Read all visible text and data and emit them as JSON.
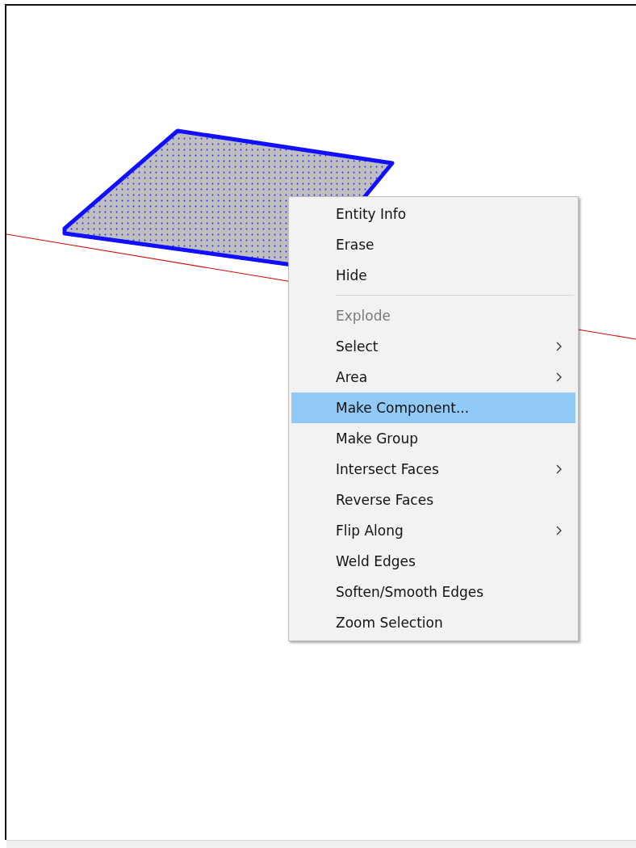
{
  "context_menu": {
    "items": [
      {
        "kind": "item",
        "label": "Entity Info",
        "disabled": false,
        "submenu": false,
        "selected": false
      },
      {
        "kind": "item",
        "label": "Erase",
        "disabled": false,
        "submenu": false,
        "selected": false
      },
      {
        "kind": "item",
        "label": "Hide",
        "disabled": false,
        "submenu": false,
        "selected": false
      },
      {
        "kind": "separator"
      },
      {
        "kind": "item",
        "label": "Explode",
        "disabled": true,
        "submenu": false,
        "selected": false
      },
      {
        "kind": "item",
        "label": "Select",
        "disabled": false,
        "submenu": true,
        "selected": false
      },
      {
        "kind": "item",
        "label": "Area",
        "disabled": false,
        "submenu": true,
        "selected": false
      },
      {
        "kind": "item",
        "label": "Make Component...",
        "disabled": false,
        "submenu": false,
        "selected": true
      },
      {
        "kind": "item",
        "label": "Make Group",
        "disabled": false,
        "submenu": false,
        "selected": false
      },
      {
        "kind": "item",
        "label": "Intersect Faces",
        "disabled": false,
        "submenu": true,
        "selected": false
      },
      {
        "kind": "item",
        "label": "Reverse Faces",
        "disabled": false,
        "submenu": false,
        "selected": false
      },
      {
        "kind": "item",
        "label": "Flip Along",
        "disabled": false,
        "submenu": true,
        "selected": false
      },
      {
        "kind": "item",
        "label": "Weld Edges",
        "disabled": false,
        "submenu": false,
        "selected": false
      },
      {
        "kind": "item",
        "label": "Soften/Smooth Edges",
        "disabled": false,
        "submenu": false,
        "selected": false
      },
      {
        "kind": "item",
        "label": "Zoom Selection",
        "disabled": false,
        "submenu": false,
        "selected": false
      }
    ]
  }
}
